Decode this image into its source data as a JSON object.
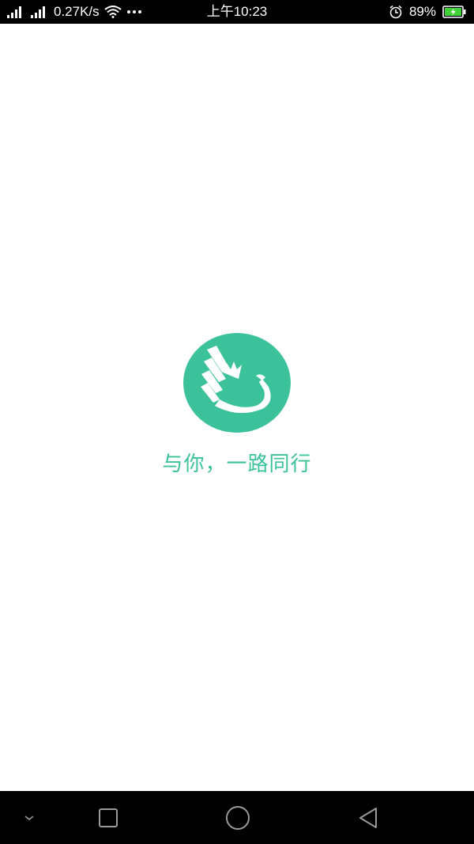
{
  "status_bar": {
    "network_speed": "0.27K/s",
    "time": "上午10:23",
    "battery_percent": "89%",
    "icons": [
      "signal-icon",
      "signal-icon",
      "wifi-icon",
      "more-dots-icon",
      "alarm-icon",
      "battery-charging-icon"
    ]
  },
  "splash": {
    "logo": "app-logo-icon",
    "slogan": "与你，一路同行",
    "accent_color": "#3cc29a"
  },
  "nav_bar": {
    "buttons": [
      "collapse-chevron-icon",
      "recents-square-icon",
      "home-circle-icon",
      "back-triangle-icon"
    ]
  }
}
